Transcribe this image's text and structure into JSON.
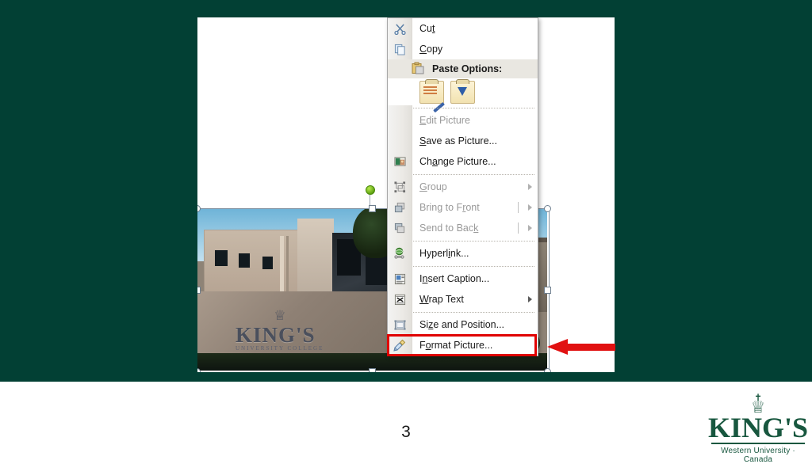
{
  "slide": {
    "page_number": "3",
    "background_color": "#024034",
    "canvas_color": "#ffffff"
  },
  "logo": {
    "cross": "✝",
    "crown": "♕",
    "wordmark": "KING'S",
    "tagline": "Western University · Canada",
    "color": "#18573f"
  },
  "picture": {
    "alt": "King's University College campus building with entrance sign",
    "sign_word": "KING'S",
    "sign_subtitle": "UNIVERSITY COLLEGE",
    "sign_crown": "♕"
  },
  "context_menu": {
    "items": [
      {
        "label": "Cut",
        "underline": "t",
        "icon": "scissors-icon",
        "icon_glyph": "✂",
        "disabled": false,
        "submenu": false,
        "separator_after": false
      },
      {
        "label": "Copy",
        "underline": "C",
        "icon": "copy-icon",
        "icon_glyph": "❐",
        "disabled": false,
        "submenu": false,
        "separator_after": false
      },
      {
        "label": "Paste Options:",
        "underline": "",
        "icon": "paste-icon",
        "icon_glyph": "📋",
        "disabled": false,
        "submenu": false,
        "separator_after": true,
        "is_header": true
      },
      {
        "label": "Edit Picture",
        "underline": "E",
        "icon": "none",
        "icon_glyph": "",
        "disabled": true,
        "submenu": false,
        "separator_after": false
      },
      {
        "label": "Save as Picture...",
        "underline": "S",
        "icon": "none",
        "icon_glyph": "",
        "disabled": false,
        "submenu": false,
        "separator_after": false
      },
      {
        "label": "Change Picture...",
        "underline": "a",
        "icon": "change-picture-icon",
        "icon_glyph": "🖼",
        "disabled": false,
        "submenu": false,
        "separator_after": true
      },
      {
        "label": "Group",
        "underline": "G",
        "icon": "group-icon",
        "icon_glyph": "◱",
        "disabled": true,
        "submenu": true,
        "separator_after": false
      },
      {
        "label": "Bring to Front",
        "underline": "R",
        "icon": "bring-to-front-icon",
        "icon_glyph": "❏",
        "disabled": true,
        "submenu": true,
        "separator_after": false
      },
      {
        "label": "Send to Back",
        "underline": "k",
        "icon": "send-to-back-icon",
        "icon_glyph": "❏",
        "disabled": true,
        "submenu": true,
        "separator_after": true
      },
      {
        "label": "Hyperlink...",
        "underline": "i",
        "icon": "hyperlink-icon",
        "icon_glyph": "🌐",
        "disabled": false,
        "submenu": false,
        "separator_after": true
      },
      {
        "label": "Insert Caption...",
        "underline": "n",
        "icon": "insert-caption-icon",
        "icon_glyph": "▤",
        "disabled": false,
        "submenu": false,
        "separator_after": false
      },
      {
        "label": "Wrap Text",
        "underline": "W",
        "icon": "wrap-text-icon",
        "icon_glyph": "⌗",
        "disabled": false,
        "submenu": true,
        "separator_after": true
      },
      {
        "label": "Size and Position...",
        "underline": "z",
        "icon": "size-position-icon",
        "icon_glyph": "⊞",
        "disabled": false,
        "submenu": false,
        "separator_after": false
      },
      {
        "label": "Format Picture...",
        "underline": "o",
        "icon": "format-picture-icon",
        "icon_glyph": "🖌",
        "disabled": false,
        "submenu": false,
        "separator_after": false,
        "highlighted": true
      }
    ],
    "paste_options": {
      "label": "Paste Options:",
      "buttons": [
        "keep-source-formatting-button",
        "picture-paste-button"
      ]
    }
  },
  "annotation": {
    "arrow_color": "#e11111",
    "highlight_color": "#e00000",
    "points_to": "Format Picture..."
  },
  "selection": {
    "rotation_handle_color": "#7ec61a",
    "handle_count": 8
  }
}
